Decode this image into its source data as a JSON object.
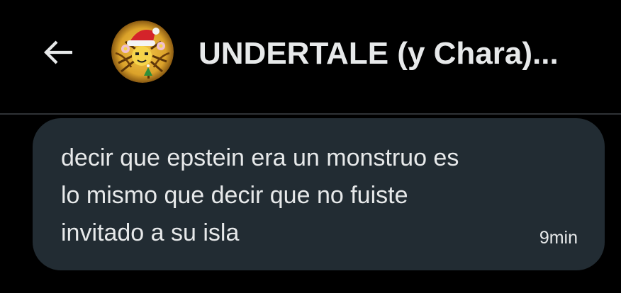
{
  "header": {
    "back_icon": "arrow-left-icon",
    "avatar_icon": "group-avatar-icon",
    "title": "UNDERTALE (y Chara)..."
  },
  "message": {
    "text": "decir que epstein era un monstruo es\nlo mismo que decir que no fuiste\ninvitado a su isla",
    "time": "9min"
  },
  "colors": {
    "background": "#000000",
    "bubble": "#222c33",
    "text": "#e7e9ea",
    "divider": "#2f3336"
  }
}
